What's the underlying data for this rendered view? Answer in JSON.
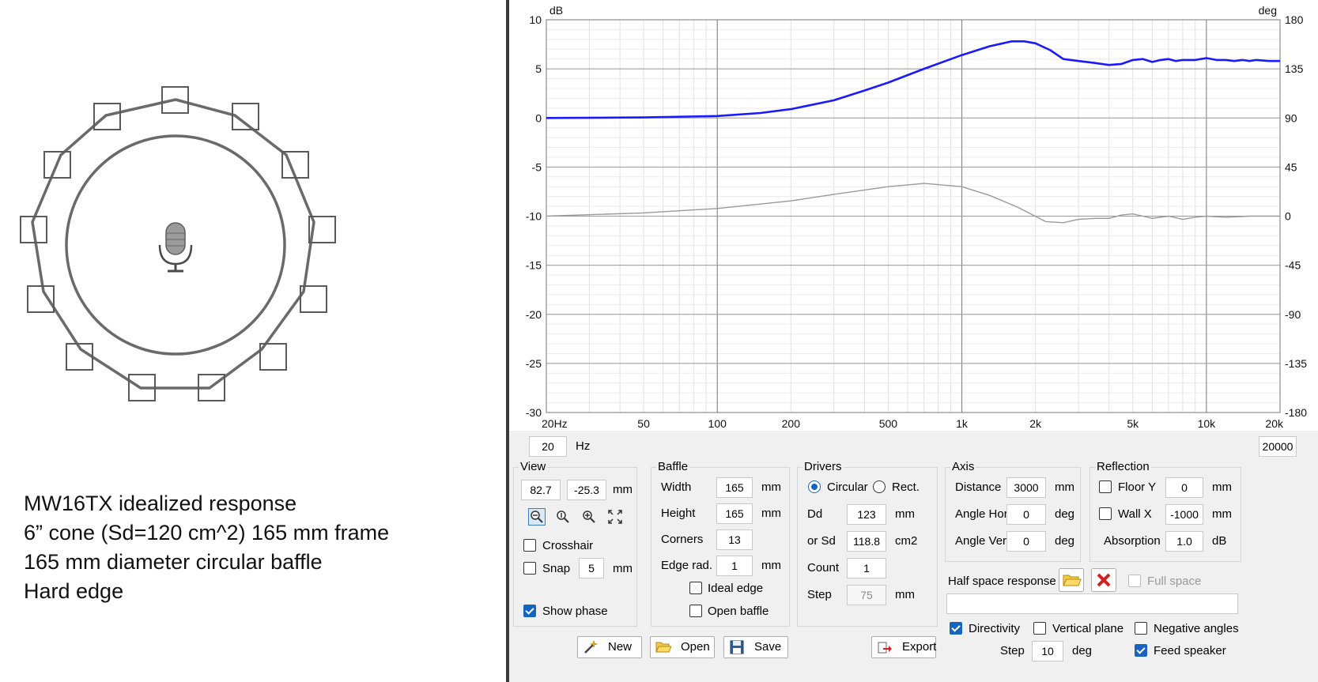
{
  "description": {
    "lines": [
      "MW16TX idealized response",
      "6” cone (Sd=120 cm^2) 165 mm frame",
      "165 mm diameter circular baffle",
      "Hard edge"
    ]
  },
  "chart_data": {
    "type": "line",
    "x_scale": "log",
    "xlim": [
      20,
      20000
    ],
    "ylim": [
      -30,
      10
    ],
    "y2lim": [
      -180,
      180
    ],
    "ylabel": "dB",
    "y2label": "deg",
    "x_ticks": [
      "20Hz",
      "50",
      "100",
      "200",
      "500",
      "1k",
      "2k",
      "5k",
      "10k",
      "20k"
    ],
    "x_tick_values": [
      20,
      50,
      100,
      200,
      500,
      1000,
      2000,
      5000,
      10000,
      20000
    ],
    "y_ticks": [
      "10",
      "5",
      "0",
      "-5",
      "-10",
      "-15",
      "-20",
      "-25",
      "-30"
    ],
    "y2_ticks": [
      "180",
      "135",
      "90",
      "45",
      "0",
      "-45",
      "-90",
      "-135",
      "-180"
    ],
    "grid": true,
    "series": [
      {
        "color": "#1a1aff",
        "axis": "left",
        "x": [
          20,
          50,
          100,
          150,
          200,
          300,
          400,
          500,
          700,
          1000,
          1300,
          1600,
          1800,
          2000,
          2300,
          2600,
          3000,
          3500,
          4000,
          4500,
          5000,
          5500,
          6000,
          6500,
          7000,
          7500,
          8000,
          9000,
          10000,
          11000,
          12000,
          13000,
          14000,
          15000,
          16000,
          18000,
          20000
        ],
        "y": [
          0,
          0.05,
          0.2,
          0.5,
          0.9,
          1.8,
          2.8,
          3.6,
          5.0,
          6.4,
          7.3,
          7.8,
          7.8,
          7.6,
          6.9,
          6.0,
          5.8,
          5.6,
          5.4,
          5.5,
          5.9,
          6.0,
          5.7,
          5.9,
          6.0,
          5.8,
          5.9,
          5.9,
          6.1,
          5.9,
          5.9,
          5.8,
          5.9,
          5.8,
          5.9,
          5.8,
          5.8
        ]
      },
      {
        "color": "#9a9a9a",
        "axis": "right",
        "x": [
          20,
          50,
          100,
          200,
          300,
          500,
          700,
          1000,
          1300,
          1700,
          2200,
          2600,
          3000,
          3500,
          4000,
          4500,
          5000,
          5500,
          6000,
          7000,
          8000,
          9000,
          10000,
          12000,
          15000,
          20000
        ],
        "y": [
          0,
          3,
          7,
          14,
          20,
          27,
          30,
          27,
          19,
          8,
          -5,
          -6,
          -3,
          -2,
          -2,
          1,
          2,
          0,
          -2,
          0,
          -3,
          -1,
          0,
          -1,
          0,
          0
        ]
      }
    ]
  },
  "range": {
    "min": "20",
    "unit": "Hz",
    "max": "20000"
  },
  "view": {
    "title": "View",
    "x": "82.7",
    "y": "-25.3",
    "unit": "mm",
    "tools": [
      "zoom-out-icon",
      "zoom-fit-icon",
      "zoom-in-icon",
      "fullscreen-icon"
    ],
    "crosshair_label": "Crosshair",
    "crosshair": false,
    "snap_label": "Snap",
    "snap": false,
    "snap_value": "5",
    "snap_unit": "mm",
    "show_phase_label": "Show phase",
    "show_phase": true
  },
  "baffle": {
    "title": "Baffle",
    "width_label": "Width",
    "width": "165",
    "width_unit": "mm",
    "height_label": "Height",
    "height": "165",
    "height_unit": "mm",
    "corners_label": "Corners",
    "corners": "13",
    "edge_rad_label": "Edge rad.",
    "edge_rad": "1",
    "edge_rad_unit": "mm",
    "ideal_edge_label": "Ideal edge",
    "ideal_edge": false,
    "open_baffle_label": "Open baffle",
    "open_baffle": false
  },
  "drivers": {
    "title": "Drivers",
    "circular_label": "Circular",
    "rect_label": "Rect.",
    "shape": "circular",
    "dd_label": "Dd",
    "dd": "123",
    "dd_unit": "mm",
    "sd_label": "or Sd",
    "sd": "118.8",
    "sd_unit": "cm2",
    "count_label": "Count",
    "count": "1",
    "step_label": "Step",
    "step": "75",
    "step_unit": "mm"
  },
  "axis": {
    "title": "Axis",
    "distance_label": "Distance",
    "distance": "3000",
    "distance_unit": "mm",
    "angle_hor_label": "Angle Hor",
    "angle_hor": "0",
    "angle_hor_unit": "deg",
    "angle_ver_label": "Angle Ver",
    "angle_ver": "0",
    "angle_ver_unit": "deg"
  },
  "reflection": {
    "title": "Reflection",
    "floor_label": "Floor Y",
    "floor": false,
    "floor_value": "0",
    "floor_unit": "mm",
    "wall_label": "Wall  X",
    "wall": false,
    "wall_value": "-1000",
    "wall_unit": "mm",
    "absorption_label": "Absorption",
    "absorption": "1.0",
    "absorption_unit": "dB"
  },
  "half_space": {
    "label": "Half space response",
    "full_space_label": "Full space",
    "path": ""
  },
  "directivity": {
    "directivity_label": "Directivity",
    "directivity": true,
    "vertical_plane_label": "Vertical plane",
    "vertical_plane": false,
    "negative_angles_label": "Negative angles",
    "negative_angles": false,
    "step_label": "Step",
    "step": "10",
    "step_unit": "deg",
    "feed_speaker_label": "Feed speaker",
    "feed_speaker": true
  },
  "buttons": {
    "new": "New",
    "open": "Open",
    "save": "Save",
    "export": "Export"
  }
}
